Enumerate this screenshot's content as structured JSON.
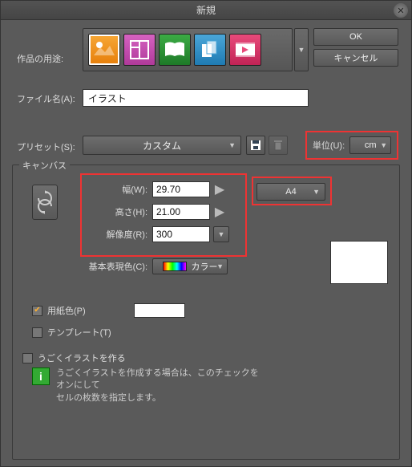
{
  "title": "新規",
  "buttons": {
    "ok": "OK",
    "cancel": "キャンセル"
  },
  "purpose": {
    "label": "作品の用途:"
  },
  "filename": {
    "label": "ファイル名(A):",
    "value": "イラスト"
  },
  "preset": {
    "label": "プリセット(S):",
    "value": "カスタム"
  },
  "unit": {
    "label": "単位(U):",
    "value": "cm"
  },
  "canvas": {
    "group": "キャンバス",
    "width_label": "幅(W):",
    "width_value": "29.70",
    "height_label": "高さ(H):",
    "height_value": "21.00",
    "res_label": "解像度(R):",
    "res_value": "300",
    "size_preset": "A4",
    "colormode_label": "基本表現色(C):",
    "colormode_value": "カラー"
  },
  "paper": {
    "label": "用紙色(P)"
  },
  "template": {
    "label": "テンプレート(T)"
  },
  "anim": {
    "label": "うごくイラストを作る"
  },
  "info": {
    "text1": "うごくイラストを作成する場合は、このチェックをオンにして",
    "text2": "セルの枚数を指定します。"
  }
}
